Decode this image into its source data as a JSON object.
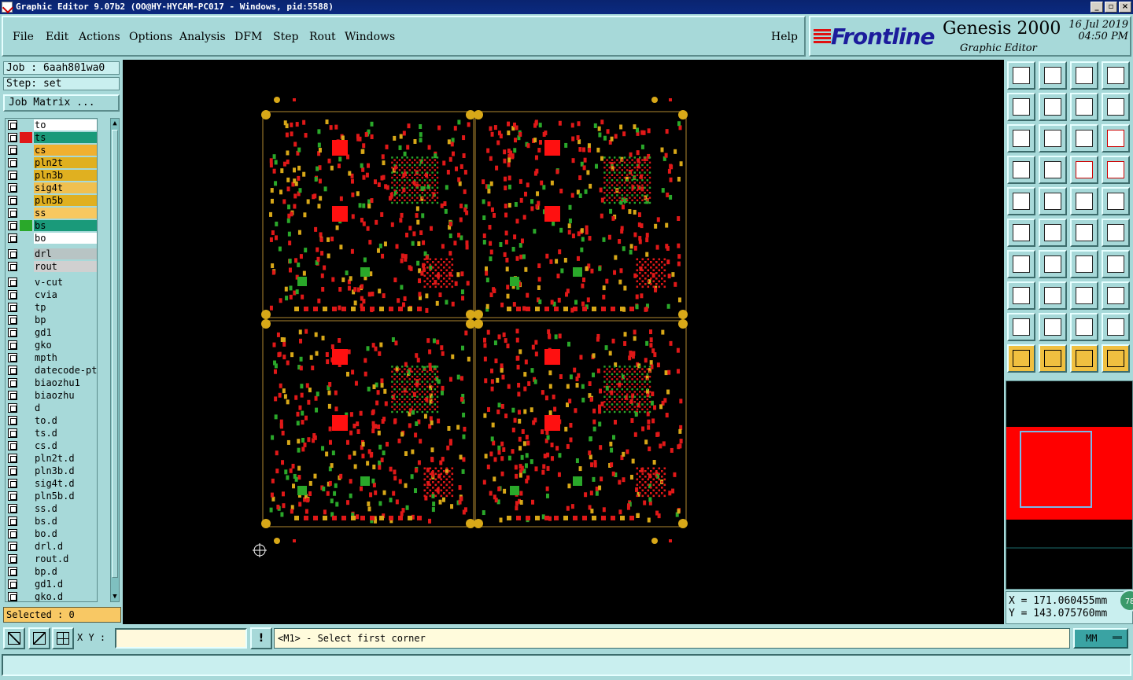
{
  "window": {
    "title": "Graphic Editor 9.07b2 (OO@HY-HYCAM-PC017 - Windows, pid:5588)"
  },
  "menu": [
    "File",
    "Edit",
    "Actions",
    "Options",
    "Analysis",
    "DFM",
    "Step",
    "Rout",
    "Windows"
  ],
  "help_label": "Help",
  "brand": {
    "logo": "Frontline",
    "product": "Genesis 2000",
    "subtitle": "Graphic Editor",
    "date": "16 Jul 2019",
    "time": "04:50 PM"
  },
  "job": {
    "job_line": "Job : 6aah801wa0",
    "step_line": "Step: set",
    "matrix_button": "Job Matrix ..."
  },
  "layers": {
    "board": [
      {
        "name": "to",
        "bg": "#ffffff",
        "swatch": ""
      },
      {
        "name": "ts",
        "bg": "#1a9a7a",
        "swatch": "#e01818"
      },
      {
        "name": "cs",
        "bg": "#f0b030",
        "swatch": ""
      },
      {
        "name": "pln2t",
        "bg": "#e0b020",
        "swatch": ""
      },
      {
        "name": "pln3b",
        "bg": "#e0b020",
        "swatch": ""
      },
      {
        "name": "sig4t",
        "bg": "#f0c050",
        "swatch": ""
      },
      {
        "name": "pln5b",
        "bg": "#e0b020",
        "swatch": ""
      },
      {
        "name": "ss",
        "bg": "#f8c860",
        "swatch": ""
      },
      {
        "name": "bs",
        "bg": "#1a9a7a",
        "swatch": "#2aa82a"
      },
      {
        "name": "bo",
        "bg": "#ffffff",
        "swatch": ""
      }
    ],
    "drill": [
      {
        "name": "drl",
        "bg": "#b8c4c4",
        "swatch": ""
      },
      {
        "name": "rout",
        "bg": "#d0d0d0",
        "swatch": ""
      }
    ],
    "misc": [
      {
        "name": "v-cut",
        "bg": "#a7d9d9",
        "swatch": ""
      },
      {
        "name": "cvia",
        "bg": "#a7d9d9",
        "swatch": ""
      },
      {
        "name": "tp",
        "bg": "#a7d9d9",
        "swatch": ""
      },
      {
        "name": "bp",
        "bg": "#a7d9d9",
        "swatch": ""
      },
      {
        "name": "gd1",
        "bg": "#a7d9d9",
        "swatch": ""
      },
      {
        "name": "gko",
        "bg": "#a7d9d9",
        "swatch": ""
      },
      {
        "name": "mpth",
        "bg": "#a7d9d9",
        "swatch": ""
      },
      {
        "name": "datecode-pt",
        "bg": "#a7d9d9",
        "swatch": ""
      },
      {
        "name": "biaozhu1",
        "bg": "#a7d9d9",
        "swatch": ""
      },
      {
        "name": "biaozhu",
        "bg": "#a7d9d9",
        "swatch": ""
      },
      {
        "name": "d",
        "bg": "#a7d9d9",
        "swatch": ""
      },
      {
        "name": "to.d",
        "bg": "#a7d9d9",
        "swatch": ""
      },
      {
        "name": "ts.d",
        "bg": "#a7d9d9",
        "swatch": ""
      },
      {
        "name": "cs.d",
        "bg": "#a7d9d9",
        "swatch": ""
      },
      {
        "name": "pln2t.d",
        "bg": "#a7d9d9",
        "swatch": ""
      },
      {
        "name": "pln3b.d",
        "bg": "#a7d9d9",
        "swatch": ""
      },
      {
        "name": "sig4t.d",
        "bg": "#a7d9d9",
        "swatch": ""
      },
      {
        "name": "pln5b.d",
        "bg": "#a7d9d9",
        "swatch": ""
      },
      {
        "name": "ss.d",
        "bg": "#a7d9d9",
        "swatch": ""
      },
      {
        "name": "bs.d",
        "bg": "#a7d9d9",
        "swatch": ""
      },
      {
        "name": "bo.d",
        "bg": "#a7d9d9",
        "swatch": ""
      },
      {
        "name": "drl.d",
        "bg": "#a7d9d9",
        "swatch": ""
      },
      {
        "name": "rout.d",
        "bg": "#a7d9d9",
        "swatch": ""
      },
      {
        "name": "bp.d",
        "bg": "#a7d9d9",
        "swatch": ""
      },
      {
        "name": "gd1.d",
        "bg": "#a7d9d9",
        "swatch": ""
      },
      {
        "name": "gko.d",
        "bg": "#a7d9d9",
        "swatch": ""
      }
    ]
  },
  "selected": "Selected : 0",
  "coords": {
    "x": "X = 171.060455mm",
    "y": "Y = 143.075760mm"
  },
  "badge": "78",
  "bottom": {
    "xy_label": "X Y :",
    "xy_value": "",
    "prompt": "<M1> - Select first corner",
    "units": "MM"
  },
  "icons": [
    "window-icon",
    "minimize-icon",
    "maximize-icon",
    "close-icon",
    "zoom-box-icon",
    "pan-icon",
    "grid-icon",
    "info-icon",
    "pointer-icon",
    "snap-icon"
  ]
}
